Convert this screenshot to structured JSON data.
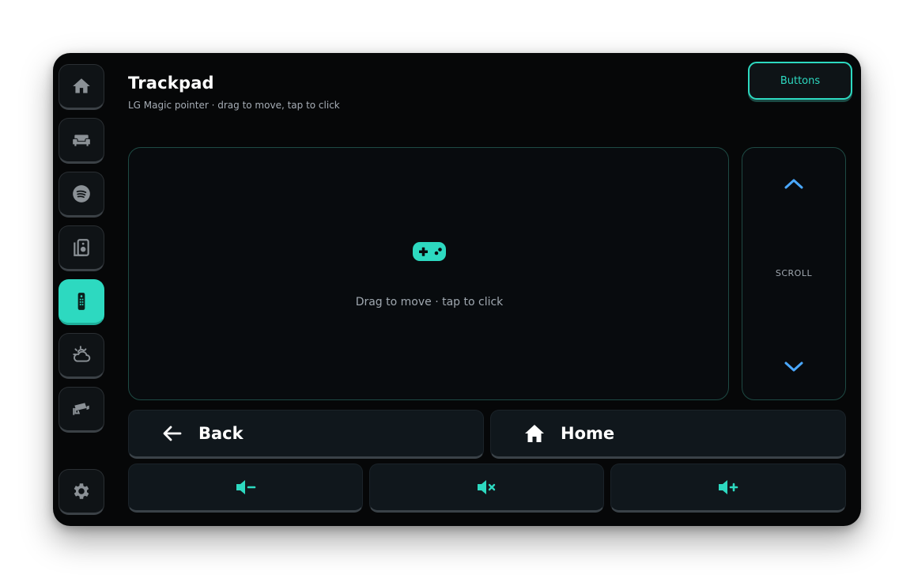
{
  "header": {
    "title": "Trackpad",
    "subtitle": "LG Magic pointer · drag to move, tap to click",
    "buttons_label": "Buttons"
  },
  "sidebar": {
    "items": [
      {
        "icon": "home-icon",
        "active": false
      },
      {
        "icon": "sofa-icon",
        "active": false
      },
      {
        "icon": "spotify-icon",
        "active": false
      },
      {
        "icon": "speaker-icon",
        "active": false
      },
      {
        "icon": "remote-icon",
        "active": true
      },
      {
        "icon": "weather-icon",
        "active": false
      },
      {
        "icon": "camera-icon",
        "active": false
      },
      {
        "icon": "gear-icon",
        "active": false
      }
    ]
  },
  "trackpad": {
    "icon": "gamepad-icon",
    "hint": "Drag to move · tap to click"
  },
  "scroll": {
    "label": "SCROLL"
  },
  "nav": {
    "back_label": "Back",
    "home_label": "Home"
  },
  "volume": {
    "down_icon": "volume-down-icon",
    "mute_icon": "volume-mute-icon",
    "up_icon": "volume-up-icon"
  },
  "colors": {
    "accent": "#2dd9c0",
    "arrow": "#4aa8ff",
    "background": "#060708",
    "icon_gray": "#8b9196"
  }
}
